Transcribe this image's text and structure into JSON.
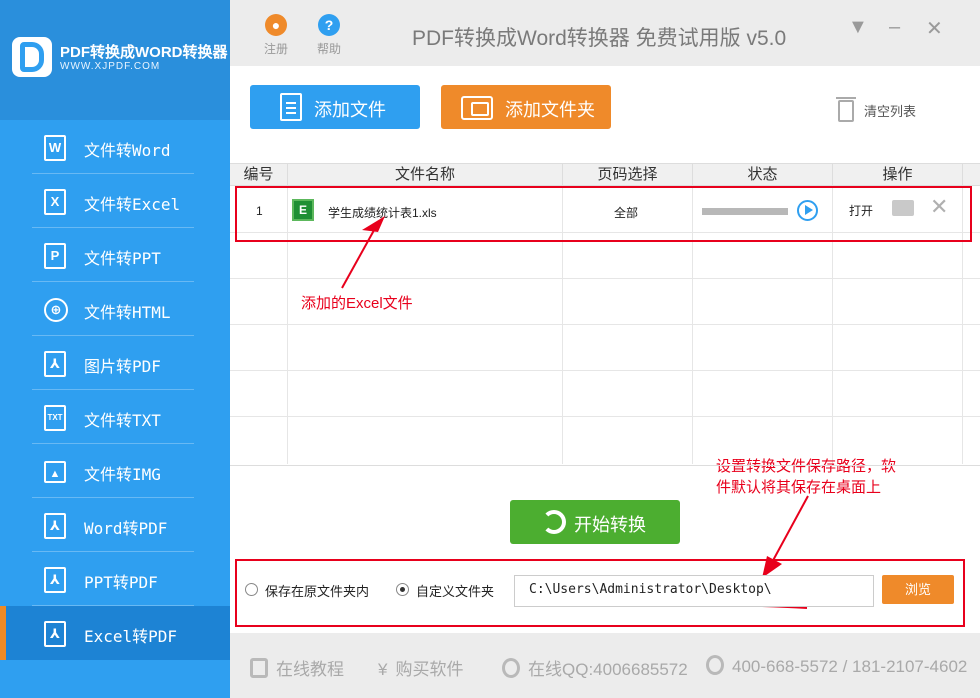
{
  "sidebar": {
    "logo": {
      "title": "PDF转换成WORD转换器",
      "url": "WWW.XJPDF.COM"
    },
    "items": [
      {
        "label": "文件转Word",
        "icon": "W"
      },
      {
        "label": "文件转Excel",
        "icon": "X"
      },
      {
        "label": "文件转PPT",
        "icon": "P"
      },
      {
        "label": "文件转HTML",
        "icon": "globe"
      },
      {
        "label": "图片转PDF",
        "icon": "pdf"
      },
      {
        "label": "文件转TXT",
        "icon": "TXT"
      },
      {
        "label": "文件转IMG",
        "icon": "img"
      },
      {
        "label": "Word转PDF",
        "icon": "pdf"
      },
      {
        "label": "PPT转PDF",
        "icon": "pdf"
      },
      {
        "label": "Excel转PDF",
        "icon": "pdf",
        "active": true
      }
    ]
  },
  "topbar": {
    "register": "注册",
    "help": "帮助",
    "title": "PDF转换成Word转换器 免费试用版 v5.0"
  },
  "toolbar": {
    "add_file": "添加文件",
    "add_folder": "添加文件夹",
    "clear_list": "清空列表"
  },
  "table": {
    "headers": [
      "编号",
      "文件名称",
      "页码选择",
      "状态",
      "操作"
    ],
    "rows": [
      {
        "index": "1",
        "name": "学生成绩统计表1.xls",
        "file_icon": "E",
        "pages": "全部",
        "open": "打开"
      }
    ]
  },
  "annotations": {
    "excel_file": "添加的Excel文件",
    "save_path": [
      "设置转换文件保存路径，软",
      "件默认将其保存在桌面上"
    ]
  },
  "conversion": {
    "start": "开始转换",
    "save_original": "保存在原文件夹内",
    "custom_folder": "自定义文件夹",
    "path": "C:\\Users\\Administrator\\Desktop\\",
    "browse": "浏览"
  },
  "footer": {
    "tutorial": "在线教程",
    "buy": "购买软件",
    "qq": "在线QQ:4006685572",
    "phone": "400-668-5572 / 181-2107-4602"
  },
  "colors": {
    "blue": "#2f9ff0",
    "orange": "#ef8a2a",
    "green": "#4cae30",
    "red": "#e8001c"
  }
}
